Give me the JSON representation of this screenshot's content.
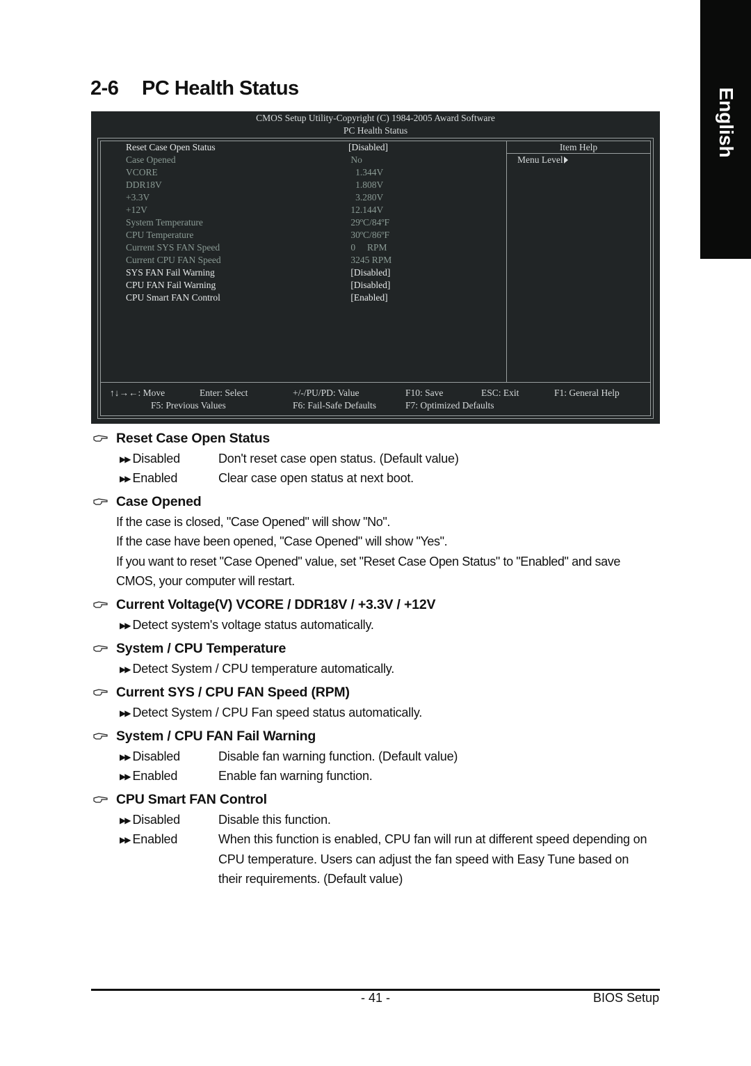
{
  "language_tab": "English",
  "section": {
    "number": "2-6",
    "title": "PC Health Status"
  },
  "bios": {
    "header_line1": "CMOS Setup Utility-Copyright (C) 1984-2005 Award Software",
    "header_line2": "PC Health Status",
    "item_help_title": "Item Help",
    "menu_level_label": "Menu Level",
    "rows": [
      {
        "label": "Reset Case Open Status",
        "value": "[Disabled]",
        "style": "bright"
      },
      {
        "label": "Case Opened",
        "value": " No",
        "style": "dim"
      },
      {
        "label": "VCORE",
        "value": "   1.344V",
        "style": "dim"
      },
      {
        "label": "DDR18V",
        "value": "   1.808V",
        "style": "dim"
      },
      {
        "label": "+3.3V",
        "value": "   3.280V",
        "style": "dim"
      },
      {
        "label": "+12V",
        "value": " 12.144V",
        "style": "dim"
      },
      {
        "label": "System Temperature",
        "value": " 29ºC/84ºF",
        "style": "dim"
      },
      {
        "label": "CPU Temperature",
        "value": " 30ºC/86ºF",
        "style": "dim"
      },
      {
        "label": "Current SYS FAN Speed",
        "value": " 0     RPM",
        "style": "dim"
      },
      {
        "label": "Current CPU FAN Speed",
        "value": " 3245 RPM",
        "style": "dim"
      },
      {
        "label": "SYS FAN Fail Warning",
        "value": " [Disabled]",
        "style": "bright"
      },
      {
        "label": "CPU FAN Fail Warning",
        "value": " [Disabled]",
        "style": "bright"
      },
      {
        "label": "CPU Smart FAN Control",
        "value": " [Enabled]",
        "style": "bright"
      }
    ],
    "keys": {
      "move": "↑↓→←: Move",
      "enter": "Enter: Select",
      "value": "+/-/PU/PD: Value",
      "f10": "F10: Save",
      "esc": "ESC: Exit",
      "f1": "F1: General Help",
      "f5": "F5: Previous Values",
      "f6": "F6: Fail-Safe Defaults",
      "f7": "F7: Optimized Defaults"
    }
  },
  "sections": {
    "reset_case": {
      "heading": "Reset Case Open Status",
      "options": [
        {
          "name": "Disabled",
          "desc": "Don't reset case open status. (Default value)"
        },
        {
          "name": "Enabled",
          "desc": "Clear case open status at next boot."
        }
      ]
    },
    "case_opened": {
      "heading": "Case Opened",
      "lines": [
        "If the case is closed, \"Case Opened\" will show \"No\".",
        "If the case have been opened, \"Case Opened\" will show \"Yes\".",
        "If you want to reset \"Case Opened\" value, set \"Reset Case Open Status\" to \"Enabled\" and save",
        "CMOS, your computer will restart."
      ]
    },
    "voltage": {
      "heading": "Current Voltage(V) VCORE / DDR18V / +3.3V / +12V",
      "note": "Detect system's voltage status automatically."
    },
    "temperature": {
      "heading": "System / CPU Temperature",
      "note": "Detect System / CPU temperature automatically."
    },
    "fan_speed": {
      "heading": "Current SYS / CPU FAN Speed (RPM)",
      "note": "Detect System / CPU Fan speed status automatically."
    },
    "fan_fail": {
      "heading": "System / CPU FAN Fail Warning",
      "options": [
        {
          "name": "Disabled",
          "desc": "Disable fan warning function. (Default value)"
        },
        {
          "name": "Enabled",
          "desc": "Enable fan warning function."
        }
      ]
    },
    "smart_fan": {
      "heading": "CPU Smart FAN Control",
      "options": [
        {
          "name": "Disabled",
          "desc": "Disable this function."
        },
        {
          "name": "Enabled",
          "desc_lines": [
            "When this function is enabled, CPU fan will run at different speed depending on",
            "CPU temperature. Users can adjust the fan speed with Easy Tune based on",
            "their requirements. (Default value)"
          ]
        }
      ]
    }
  },
  "footer": {
    "page_number": "- 41 -",
    "chapter": "BIOS Setup"
  },
  "icons": {
    "bullet": "pointing-hand-icon",
    "option": "double-triangle-icon"
  }
}
